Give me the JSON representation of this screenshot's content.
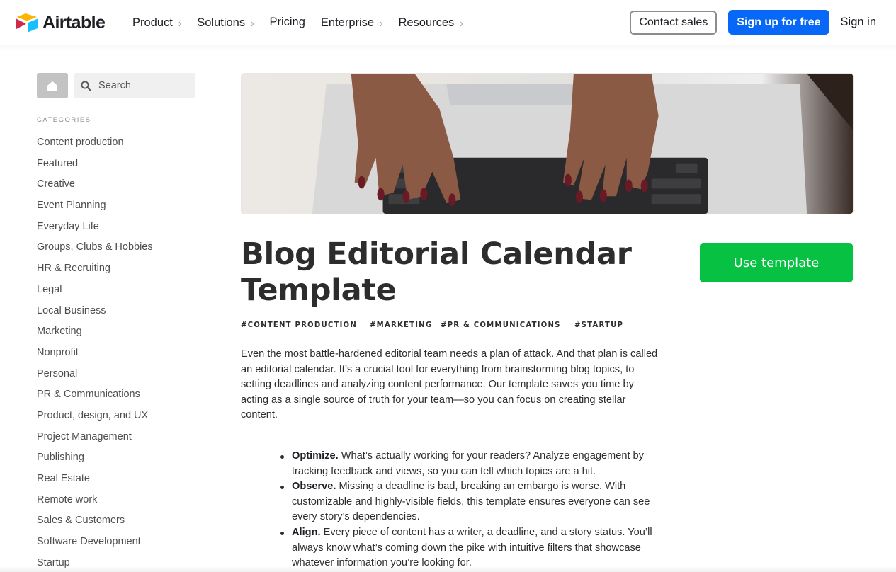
{
  "brand": {
    "name": "Airtable",
    "colors": {
      "yellow": "#fcb400",
      "red": "#e8385b",
      "blue": "#18bfff",
      "dark_red": "#ba1e45"
    }
  },
  "nav": {
    "items": [
      {
        "label": "Product",
        "has_chevron": true
      },
      {
        "label": "Solutions",
        "has_chevron": true
      },
      {
        "label": "Pricing",
        "has_chevron": false
      },
      {
        "label": "Enterprise",
        "has_chevron": true
      },
      {
        "label": "Resources",
        "has_chevron": true
      }
    ],
    "chevron_glyph": "›",
    "contact_sales": "Contact sales",
    "sign_up": "Sign up for free",
    "sign_in": "Sign in",
    "accent": "#0768f8"
  },
  "sidebar": {
    "home_icon": "home-icon",
    "search_icon": "search-icon",
    "search_placeholder": "Search",
    "categories_heading": "CATEGORIES",
    "categories": [
      "Content production",
      "Featured",
      "Creative",
      "Event Planning",
      "Everyday Life",
      "Groups, Clubs & Hobbies",
      "HR & Recruiting",
      "Legal",
      "Local Business",
      "Marketing",
      "Nonprofit",
      "Personal",
      "PR & Communications",
      "Product, design, and UX",
      "Project Management",
      "Publishing",
      "Real Estate",
      "Remote work",
      "Sales & Customers",
      "Software Development",
      "Startup"
    ]
  },
  "main": {
    "hero_image_alt": "Hands typing on a laptop keyboard",
    "title": "Blog Editorial Calendar Template",
    "use_template": "Use template",
    "use_template_color": "#06c142",
    "tags": [
      "#CONTENT PRODUCTION",
      "#MARKETING",
      "#PR & COMMUNICATIONS",
      "#STARTUP"
    ],
    "description": "Even the most battle-hardened editorial team needs a plan of attack. And that plan is called an editorial calendar. It’s a crucial tool for everything from brainstorming blog topics, to setting deadlines and analyzing content performance. Our template saves you time by acting as a single source of truth for your team—so you can focus on creating stellar content.",
    "bullets": [
      {
        "lead": "Optimize.",
        "text": " What’s actually working for your readers? Analyze engagement by tracking feedback and views, so you can tell which topics are a hit."
      },
      {
        "lead": "Observe.",
        "text": " Missing a deadline is bad, breaking an embargo is worse. With customizable and highly-visible fields, this template ensures everyone can see every story’s dependencies."
      },
      {
        "lead": "Align.",
        "text": " Every piece of content has a writer, a deadline, and a story status. You’ll always know what’s coming down the pike with intuitive filters that showcase whatever information you’re looking for."
      }
    ]
  }
}
